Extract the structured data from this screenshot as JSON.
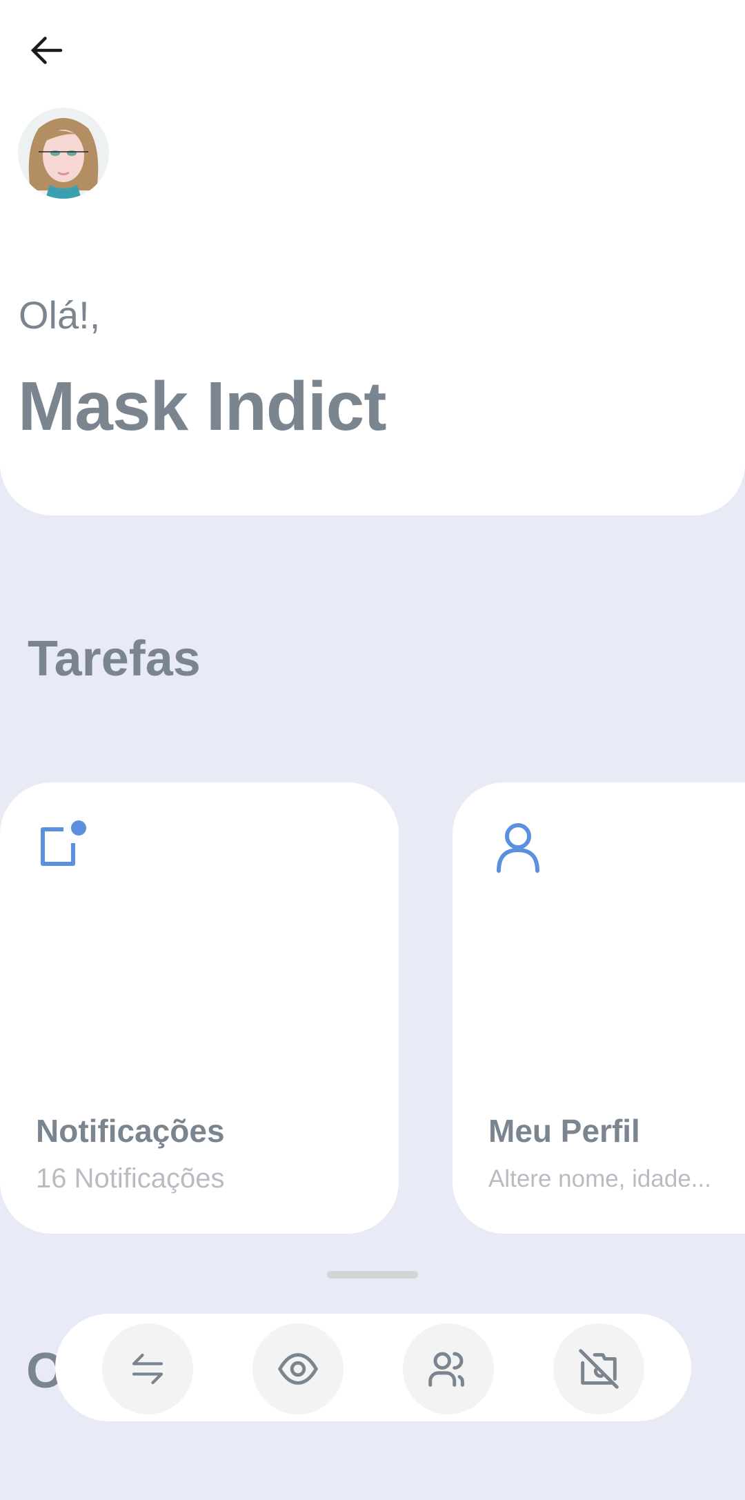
{
  "header": {
    "greeting": "Olá!,",
    "user_name": "Mask Indict"
  },
  "section_title": "Tarefas",
  "next_section_partial": "O",
  "cards": [
    {
      "title": "Notificações",
      "subtitle": "16 Notificações",
      "icon": "notification-badge-icon"
    },
    {
      "title": "Meu Perfil",
      "subtitle": "Altere nome, idade...",
      "icon": "person-icon"
    }
  ],
  "bottom_bar": [
    {
      "icon": "swap-arrows-icon"
    },
    {
      "icon": "eye-icon"
    },
    {
      "icon": "users-icon"
    },
    {
      "icon": "camera-off-icon"
    }
  ],
  "colors": {
    "background": "#e8ebf6",
    "accent": "#5b8fe0",
    "text": "#7b8590",
    "subtext": "#b8bcc2"
  }
}
